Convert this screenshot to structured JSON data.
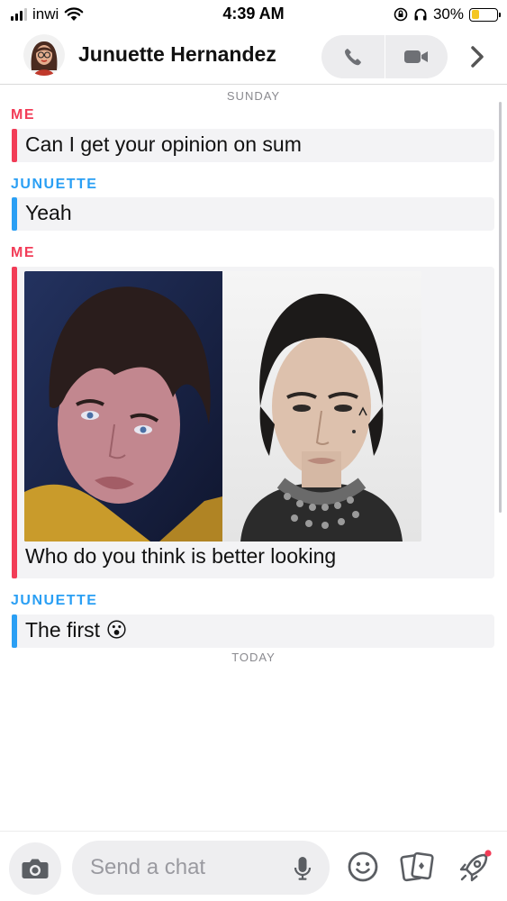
{
  "status": {
    "carrier": "inwi",
    "time": "4:39 AM",
    "battery": "30%",
    "battery_level": 0.3
  },
  "header": {
    "contact_name": "Junuette Hernandez",
    "icons": [
      "avatar",
      "phone-icon",
      "video-icon",
      "chevron-right-icon"
    ]
  },
  "chat": {
    "day_sunday": "SUNDAY",
    "day_today": "TODAY",
    "messages": [
      {
        "sender": "ME",
        "text": "Can I get your opinion on sum"
      },
      {
        "sender": "JUNUETTE",
        "text": "Yeah"
      },
      {
        "sender": "ME",
        "text": "Who do you think is better looking"
      },
      {
        "sender": "JUNUETTE",
        "text": "The first 😮"
      }
    ]
  },
  "compose": {
    "placeholder": "Send a chat",
    "icons": [
      "camera-icon",
      "mic-icon",
      "emoji-icon",
      "cards-icon",
      "rocket-icon"
    ]
  },
  "colors": {
    "me": "#f23c57",
    "them": "#2a9ff4",
    "bubble_bg": "#f3f3f5"
  }
}
